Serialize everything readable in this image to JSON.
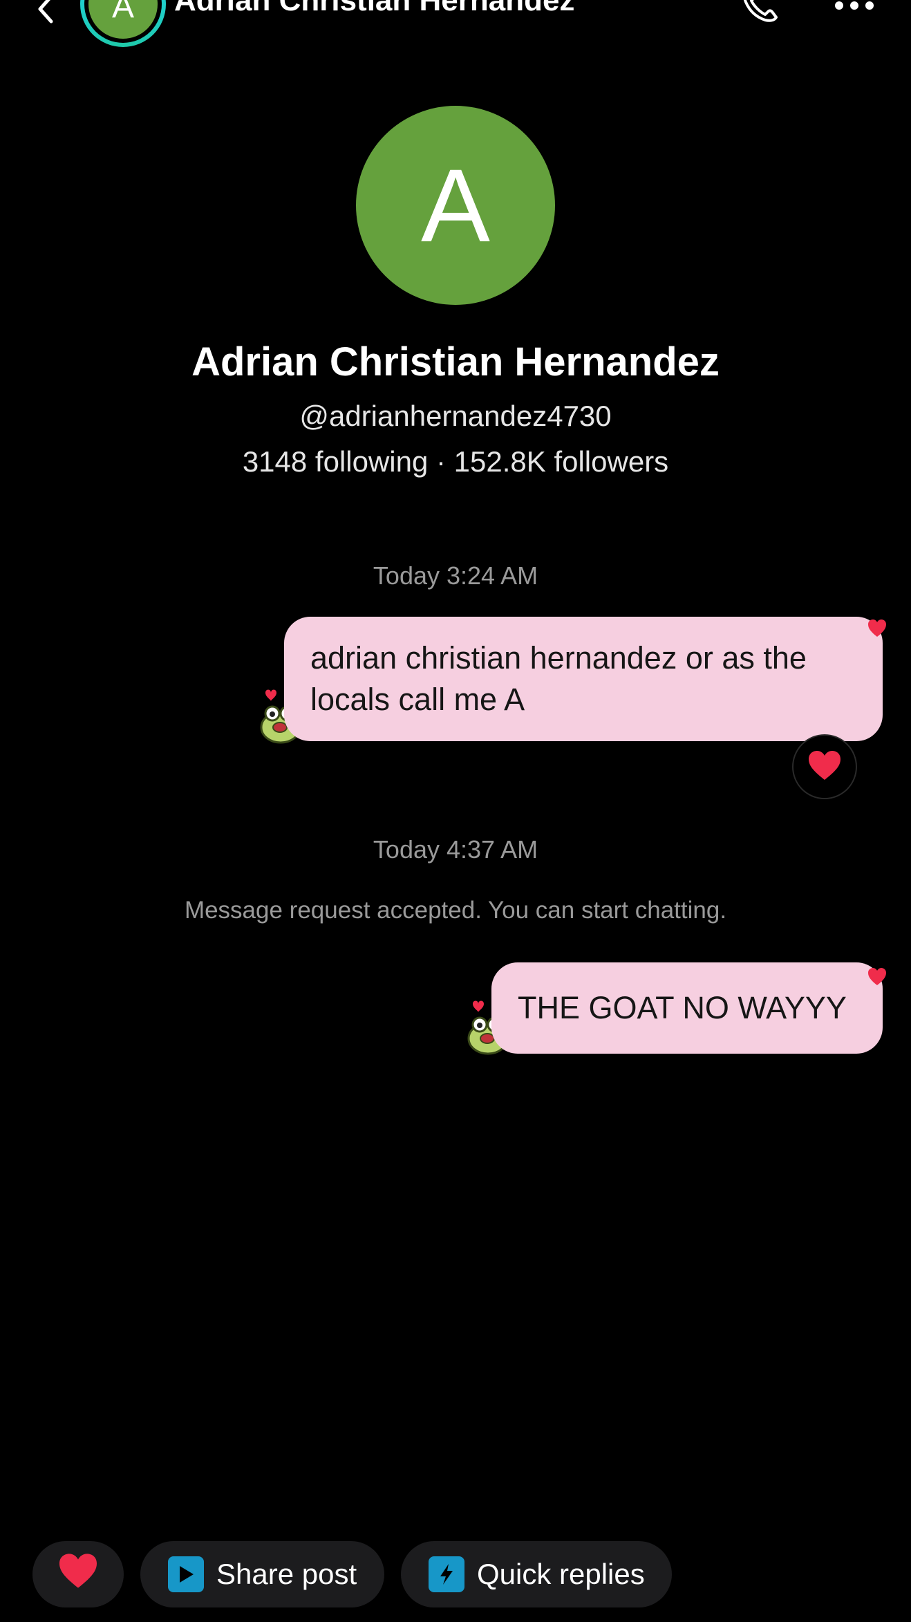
{
  "colors": {
    "background": "#000000",
    "avatar_green": "#65a13d",
    "bubble_pink": "#f6cfe0",
    "chip_bg": "#1c1c1e",
    "chip_icon_blue": "#1797c8",
    "heart_red": "#f02c4b",
    "ring_cyan": "#20d5ec",
    "muted_text": "#9a9a9a"
  },
  "header": {
    "title": "Adrian Christian Hernandez",
    "avatar_initial": "A",
    "back_icon": "chevron-left-icon",
    "call_icon": "phone-icon",
    "more_icon": "more-horizontal-icon"
  },
  "profile": {
    "avatar_initial": "A",
    "name": "Adrian Christian Hernandez",
    "handle": "@adrianhernandez4730",
    "stats": "3148 following · 152.8K followers"
  },
  "chat": {
    "messages": [
      {
        "timestamp": "Today 3:24 AM",
        "text": "adrian christian hernandez or as the locals call me A",
        "reaction": "❤️",
        "sticker_icon": "frog-heart-sticker-icon"
      },
      {
        "timestamp": "Today 4:37 AM",
        "system": "Message request accepted. You can start chatting.",
        "text": "THE GOAT NO WAYYY",
        "sticker_icon": "frog-heart-sticker-icon"
      }
    ]
  },
  "quick_actions": {
    "heart_icon": "heart-icon",
    "share_post_label": "Share post",
    "share_post_icon": "play-square-icon",
    "quick_replies_label": "Quick replies",
    "quick_replies_icon": "lightning-bubble-icon"
  }
}
